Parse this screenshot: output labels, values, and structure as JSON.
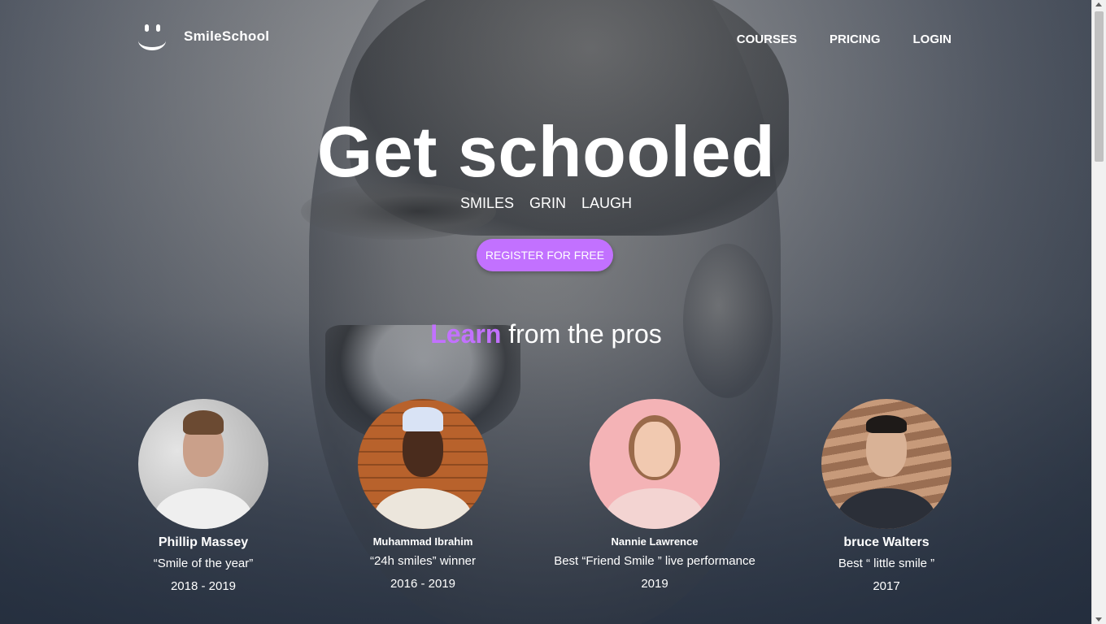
{
  "brand": {
    "name": "SmileSchool"
  },
  "nav": {
    "items": [
      "COURSES",
      "PRICING",
      "LOGIN"
    ]
  },
  "hero": {
    "title": "Get schooled",
    "tags": [
      "SMILES",
      "GRIN",
      "LAUGH"
    ],
    "cta": "REGISTER FOR FREE"
  },
  "pros": {
    "title_highlight": "Learn",
    "title_rest": " from the pros",
    "people": [
      {
        "name": "Phillip Massey",
        "quote": "“Smile of the year”",
        "years": "2018 - 2019"
      },
      {
        "name": "Muhammad Ibrahim",
        "quote": "“24h smiles” winner",
        "years": "2016 - 2019"
      },
      {
        "name": "Nannie Lawrence",
        "quote": "Best “Friend Smile ” live performance",
        "years": "2019"
      },
      {
        "name": "bruce Walters",
        "quote": "Best “ little smile ”",
        "years": "2017"
      }
    ]
  },
  "colors": {
    "accent": "#c271ff"
  }
}
